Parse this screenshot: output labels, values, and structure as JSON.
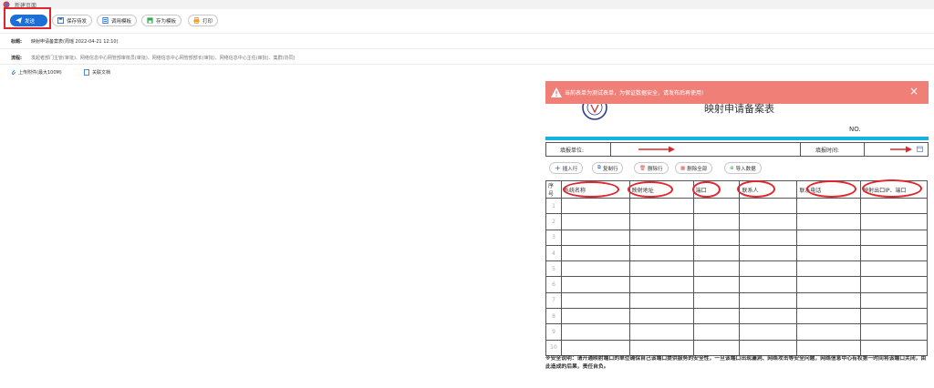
{
  "window": {
    "title": "新建页面"
  },
  "toolbar": {
    "send": "发送",
    "save_draft": "保存待发",
    "load_template": "调用模板",
    "save_template": "存为模板",
    "print": "打印"
  },
  "fields": {
    "subject_label": "标题:",
    "subject_value": "映射申请备案表(周瑶 2022-04-21 12:10)",
    "flow_label": "流程:",
    "flow_value": "发起者部门主管(审批)、网络信息中心网管部审核员(审批)、网络信息中心网管部部长(审批)、网络信息中心主任(审批)、集群(协同)",
    "upload": "上传附件(最大100M)",
    "related_doc": "关联文档"
  },
  "banner": {
    "message": "当前表单为测试表单，为保证数据安全，请发布后再使用!"
  },
  "form": {
    "title": "映射申请备案表",
    "no_label": "NO.",
    "unit_label": "填报单位:",
    "time_label": "填报时间:",
    "actions": {
      "insert": "插入行",
      "copy": "复制行",
      "delete": "删除行",
      "delete_all": "删除全部",
      "import": "导入数据"
    },
    "columns": [
      "序号",
      "系统名称",
      "映射地址",
      "端口",
      "联系人",
      "联系电话",
      "映射出口IP、端口"
    ],
    "rows": [
      "1",
      "2",
      "3",
      "4",
      "5",
      "6",
      "7",
      "8",
      "9",
      "10"
    ],
    "note": "※安全说明：请开通映射端口的单位确保自己该端口提供服务的安全性，一旦该端口出现漏洞、网络攻击等安全问题，网络信息中心有权第一时间将该端口关闭，由此造成的后果，责任自负。"
  },
  "colors": {
    "primary": "#1d6fd8",
    "banner": "#f07f78",
    "annotation": "#e0262c",
    "accent_bar": "#17b2e0"
  }
}
